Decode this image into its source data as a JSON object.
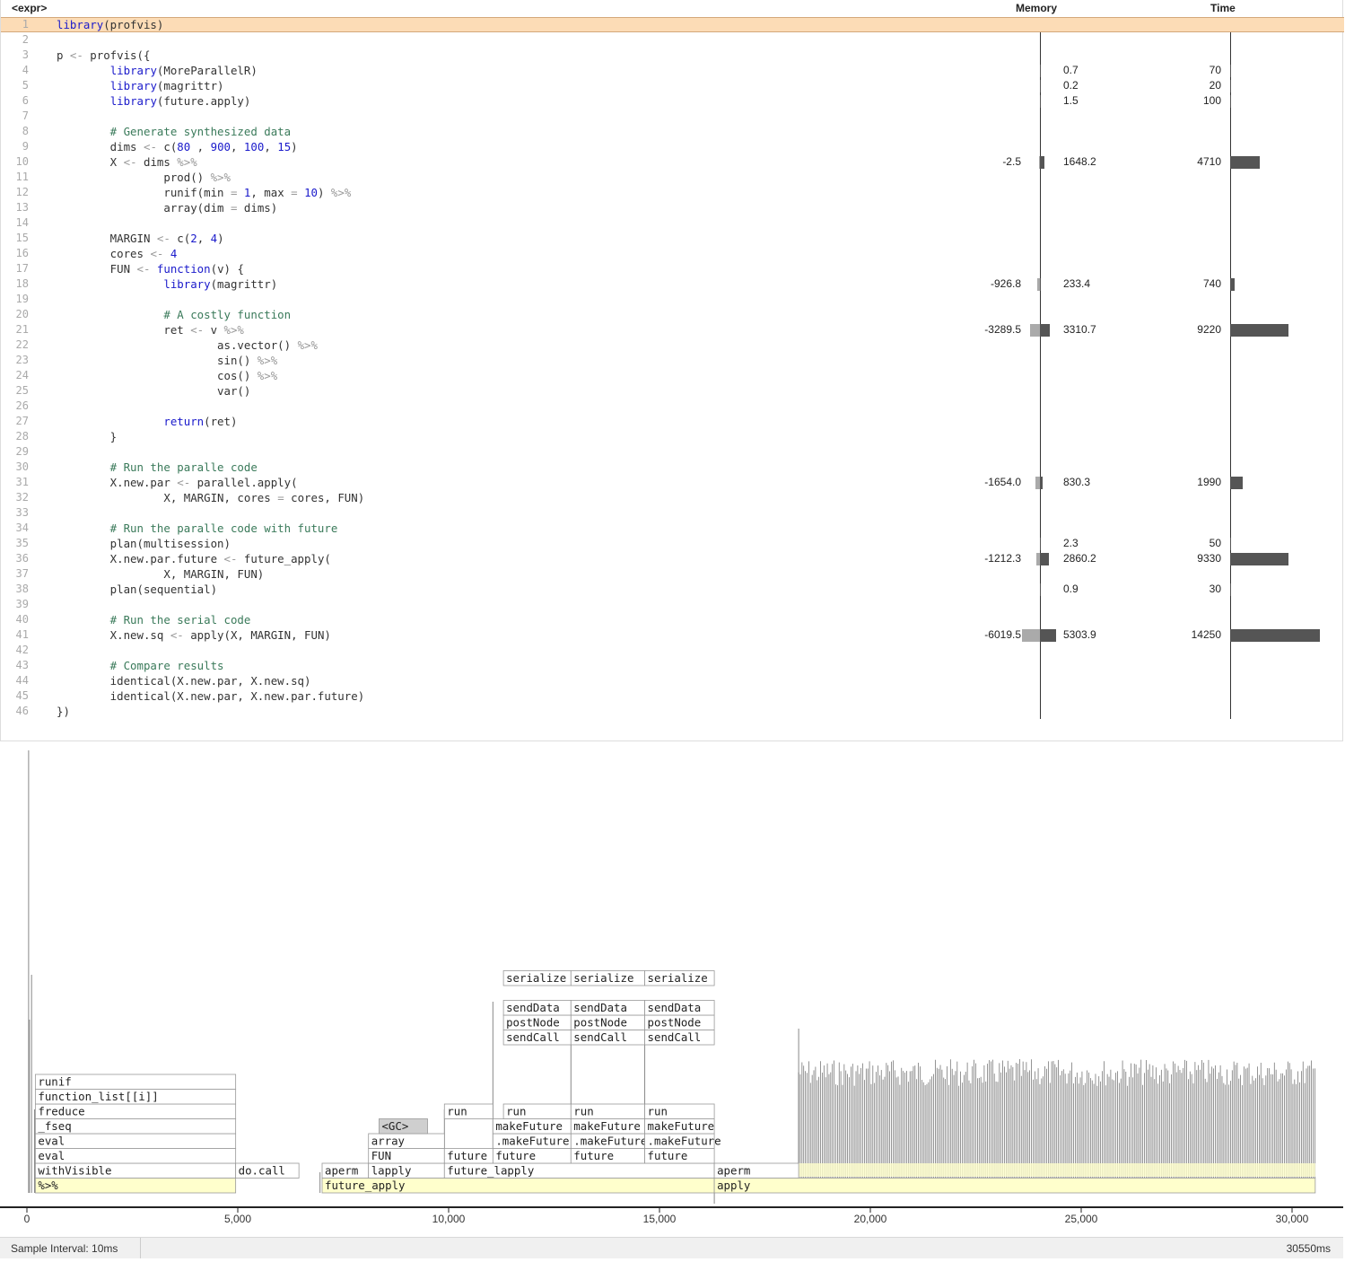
{
  "header": {
    "expr_label": "<expr>",
    "memory_label": "Memory",
    "time_label": "Time"
  },
  "code_lines": [
    {
      "n": "1",
      "t": "library(profvis)",
      "hl": true
    },
    {
      "n": "2",
      "t": ""
    },
    {
      "n": "3",
      "t": "p <- profvis({"
    },
    {
      "n": "4",
      "t": "        library(MoreParallelR)",
      "mem_pos": "0.7",
      "time": "70"
    },
    {
      "n": "5",
      "t": "        library(magrittr)",
      "mem_pos": "0.2",
      "time": "20"
    },
    {
      "n": "6",
      "t": "        library(future.apply)",
      "mem_pos": "1.5",
      "time": "100"
    },
    {
      "n": "7",
      "t": ""
    },
    {
      "n": "8",
      "t": "        # Generate synthesized data"
    },
    {
      "n": "9",
      "t": "        dims <- c(80 , 900, 100, 15)"
    },
    {
      "n": "10",
      "t": "        X <- dims %>%",
      "mem_neg": "-2.5",
      "mem_pos": "1648.2",
      "time": "4710"
    },
    {
      "n": "11",
      "t": "                prod() %>%"
    },
    {
      "n": "12",
      "t": "                runif(min = 1, max = 10) %>%"
    },
    {
      "n": "13",
      "t": "                array(dim = dims)"
    },
    {
      "n": "14",
      "t": ""
    },
    {
      "n": "15",
      "t": "        MARGIN <- c(2, 4)"
    },
    {
      "n": "16",
      "t": "        cores <- 4"
    },
    {
      "n": "17",
      "t": "        FUN <- function(v) {"
    },
    {
      "n": "18",
      "t": "                library(magrittr)",
      "mem_neg": "-926.8",
      "mem_pos": "233.4",
      "time": "740"
    },
    {
      "n": "19",
      "t": ""
    },
    {
      "n": "20",
      "t": "                # A costly function"
    },
    {
      "n": "21",
      "t": "                ret <- v %>%",
      "mem_neg": "-3289.5",
      "mem_pos": "3310.7",
      "time": "9220"
    },
    {
      "n": "22",
      "t": "                        as.vector() %>%"
    },
    {
      "n": "23",
      "t": "                        sin() %>%"
    },
    {
      "n": "24",
      "t": "                        cos() %>%"
    },
    {
      "n": "25",
      "t": "                        var()"
    },
    {
      "n": "26",
      "t": ""
    },
    {
      "n": "27",
      "t": "                return(ret)"
    },
    {
      "n": "28",
      "t": "        }"
    },
    {
      "n": "29",
      "t": ""
    },
    {
      "n": "30",
      "t": "        # Run the paralle code"
    },
    {
      "n": "31",
      "t": "        X.new.par <- parallel.apply(",
      "mem_neg": "-1654.0",
      "mem_pos": "830.3",
      "time": "1990"
    },
    {
      "n": "32",
      "t": "                X, MARGIN, cores = cores, FUN)"
    },
    {
      "n": "33",
      "t": ""
    },
    {
      "n": "34",
      "t": "        # Run the paralle code with future"
    },
    {
      "n": "35",
      "t": "        plan(multisession)",
      "mem_pos": "2.3",
      "time": "50"
    },
    {
      "n": "36",
      "t": "        X.new.par.future <- future_apply(",
      "mem_neg": "-1212.3",
      "mem_pos": "2860.2",
      "time": "9330"
    },
    {
      "n": "37",
      "t": "                X, MARGIN, FUN)"
    },
    {
      "n": "38",
      "t": "        plan(sequential)",
      "mem_pos": "0.9",
      "time": "30"
    },
    {
      "n": "39",
      "t": ""
    },
    {
      "n": "40",
      "t": "        # Run the serial code"
    },
    {
      "n": "41",
      "t": "        X.new.sq <- apply(X, MARGIN, FUN)",
      "mem_neg": "-6019.5",
      "mem_pos": "5303.9",
      "time": "14250"
    },
    {
      "n": "42",
      "t": ""
    },
    {
      "n": "43",
      "t": "        # Compare results"
    },
    {
      "n": "44",
      "t": "        identical(X.new.par, X.new.sq)"
    },
    {
      "n": "45",
      "t": "        identical(X.new.par, X.new.par.future)"
    },
    {
      "n": "46",
      "t": "})"
    }
  ],
  "flame": {
    "x_ticks": [
      "0",
      "5,000",
      "10,000",
      "15,000",
      "20,000",
      "25,000",
      "30,000"
    ],
    "blocks": [
      {
        "label": "%>%",
        "start": 200,
        "end": 4950,
        "depth": 0,
        "yellow": true
      },
      {
        "label": "future_apply",
        "start": 7000,
        "end": 16300,
        "depth": 0,
        "yellow": true
      },
      {
        "label": "apply",
        "start": 16300,
        "end": 30550,
        "depth": 0,
        "yellow": true
      },
      {
        "label": "withVisible",
        "start": 200,
        "end": 4950,
        "depth": 1
      },
      {
        "label": "do.call",
        "start": 4950,
        "end": 6450,
        "depth": 1
      },
      {
        "label": "aperm",
        "start": 7000,
        "end": 8100,
        "depth": 1
      },
      {
        "label": "lapply",
        "start": 8100,
        "end": 9900,
        "depth": 1
      },
      {
        "label": "future_lapply",
        "start": 9900,
        "end": 16300,
        "depth": 1
      },
      {
        "label": "aperm",
        "start": 16300,
        "end": 18300,
        "depth": 1
      },
      {
        "label": "eval",
        "start": 200,
        "end": 4950,
        "depth": 2
      },
      {
        "label": "FUN",
        "start": 8100,
        "end": 9900,
        "depth": 2
      },
      {
        "label": "future",
        "start": 9900,
        "end": 11050,
        "depth": 2
      },
      {
        "label": "future",
        "start": 11050,
        "end": 12900,
        "depth": 2
      },
      {
        "label": "future",
        "start": 12900,
        "end": 14650,
        "depth": 2
      },
      {
        "label": "future",
        "start": 14650,
        "end": 16300,
        "depth": 2
      },
      {
        "label": "eval",
        "start": 200,
        "end": 4950,
        "depth": 3
      },
      {
        "label": "array",
        "start": 8100,
        "end": 9900,
        "depth": 3
      },
      {
        "label": ".makeFuture",
        "start": 11050,
        "end": 12900,
        "depth": 3
      },
      {
        "label": ".makeFuture",
        "start": 12900,
        "end": 14650,
        "depth": 3
      },
      {
        "label": ".makeFuture",
        "start": 14650,
        "end": 16300,
        "depth": 3
      },
      {
        "label": "_fseq",
        "start": 200,
        "end": 4950,
        "depth": 4
      },
      {
        "label": "<GC>",
        "start": 8350,
        "end": 9500,
        "depth": 4,
        "gray": true
      },
      {
        "label": "makeFuture",
        "start": 11050,
        "end": 12900,
        "depth": 4
      },
      {
        "label": "makeFuture",
        "start": 12900,
        "end": 14650,
        "depth": 4
      },
      {
        "label": "makeFuture",
        "start": 14650,
        "end": 16300,
        "depth": 4
      },
      {
        "label": "freduce",
        "start": 200,
        "end": 4950,
        "depth": 5
      },
      {
        "label": "run",
        "start": 9900,
        "end": 11050,
        "depth": 5
      },
      {
        "label": "run",
        "start": 11300,
        "end": 12900,
        "depth": 5
      },
      {
        "label": "run",
        "start": 12900,
        "end": 14650,
        "depth": 5
      },
      {
        "label": "run",
        "start": 14650,
        "end": 16300,
        "depth": 5
      },
      {
        "label": "function_list[[i]]",
        "start": 200,
        "end": 4950,
        "depth": 6
      },
      {
        "label": "runif",
        "start": 200,
        "end": 4950,
        "depth": 7
      },
      {
        "label": "sendCall",
        "start": 11300,
        "end": 12900,
        "depth": 10
      },
      {
        "label": "sendCall",
        "start": 12900,
        "end": 14650,
        "depth": 10
      },
      {
        "label": "sendCall",
        "start": 14650,
        "end": 16300,
        "depth": 10
      },
      {
        "label": "postNode",
        "start": 11300,
        "end": 12900,
        "depth": 11
      },
      {
        "label": "postNode",
        "start": 12900,
        "end": 14650,
        "depth": 11
      },
      {
        "label": "postNode",
        "start": 14650,
        "end": 16300,
        "depth": 11
      },
      {
        "label": "sendData",
        "start": 11300,
        "end": 12900,
        "depth": 12
      },
      {
        "label": "sendData",
        "start": 12900,
        "end": 14650,
        "depth": 12
      },
      {
        "label": "sendData",
        "start": 14650,
        "end": 16300,
        "depth": 12
      },
      {
        "label": "serialize",
        "start": 11300,
        "end": 12900,
        "depth": 14
      },
      {
        "label": "serialize",
        "start": 12900,
        "end": 14650,
        "depth": 14
      },
      {
        "label": "serialize",
        "start": 14650,
        "end": 16300,
        "depth": 14
      }
    ]
  },
  "status": {
    "interval": "Sample Interval: 10ms",
    "total": "30550ms"
  }
}
